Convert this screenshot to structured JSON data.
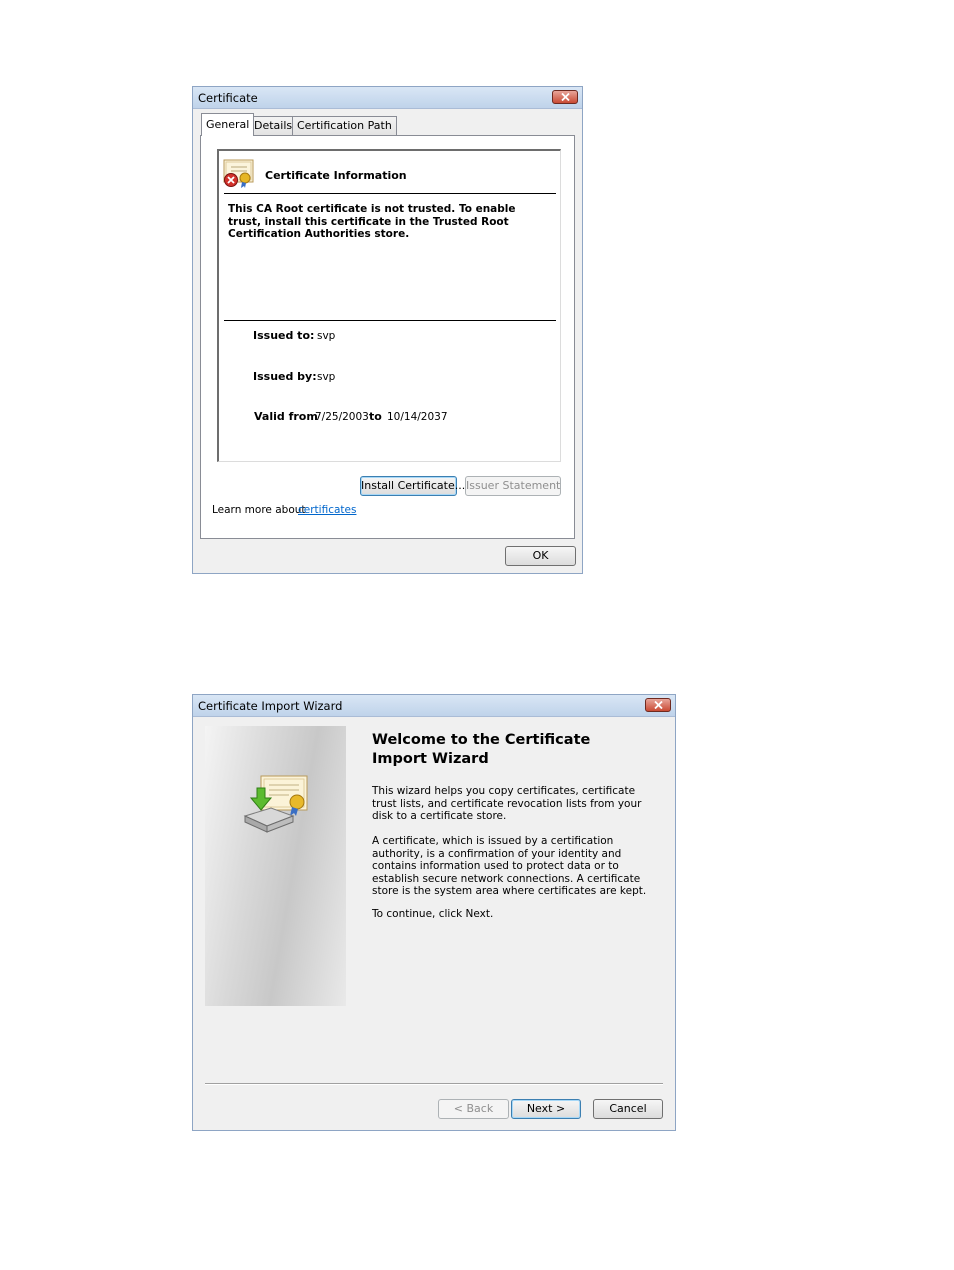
{
  "certificate_dialog": {
    "title": "Certificate",
    "tabs": [
      "General",
      "Details",
      "Certification Path"
    ],
    "info_heading": "Certificate Information",
    "warning_text": "This CA Root certificate is not trusted. To enable trust, install this certificate in the Trusted Root Certification Authorities store.",
    "issued_to_label": "Issued to:",
    "issued_to_value": "svp",
    "issued_by_label": "Issued by:",
    "issued_by_value": "svp",
    "valid_from_label": "Valid from",
    "valid_from_value": "7/25/2003",
    "valid_to_label": "to",
    "valid_to_value": "10/14/2037",
    "install_button": "Install Certificate...",
    "issuer_statement_button": "Issuer Statement",
    "learn_more_text": "Learn more about",
    "learn_more_link": "certificates",
    "ok_button": "OK"
  },
  "import_wizard": {
    "title": "Certificate Import Wizard",
    "heading": "Welcome to the Certificate Import Wizard",
    "paragraph1": "This wizard helps you copy certificates, certificate trust lists, and certificate revocation lists from your disk to a certificate store.",
    "paragraph2": "A certificate, which is issued by a certification authority, is a confirmation of your identity and contains information used to protect data or to establish secure network connections. A certificate store is the system area where certificates are kept.",
    "paragraph3": "To continue, click Next.",
    "back_button": "< Back",
    "next_button": "Next >",
    "cancel_button": "Cancel"
  },
  "icons": [
    "close-icon",
    "certificate-error-icon",
    "certificate-import-icon"
  ]
}
